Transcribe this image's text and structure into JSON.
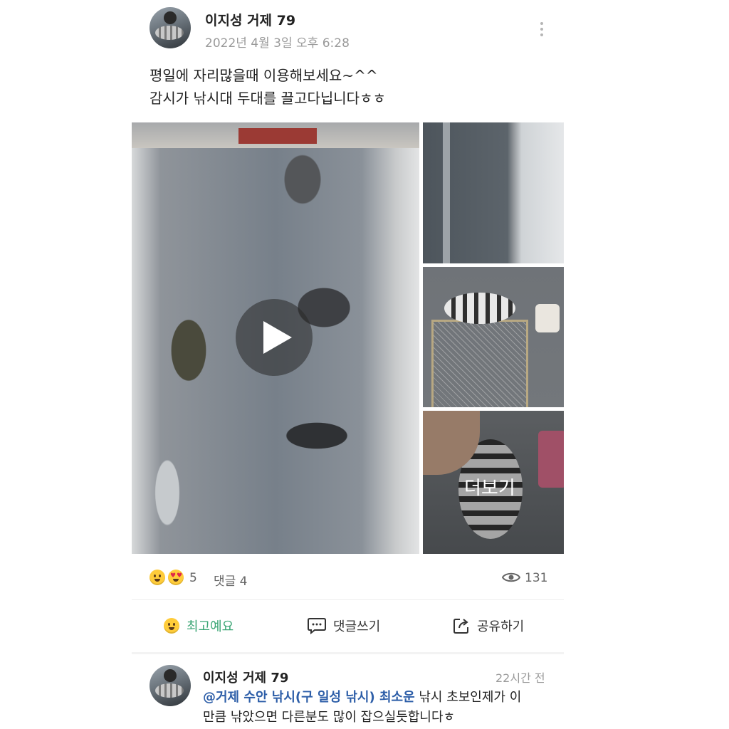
{
  "post": {
    "author": "이지성 거제 79",
    "timestamp": "2022년 4월 3일 오후 6:28",
    "text_line1": "평일에 자리많을때 이용해보세요~^^",
    "text_line2": "감시가 낚시대 두대를 끌고다닙니다ㅎㅎ",
    "media": {
      "more_label": "더보기"
    },
    "stats": {
      "reaction_count": "5",
      "comment_count_label": "댓글 4",
      "view_count": "131"
    },
    "actions": {
      "like_label": "최고예요",
      "comment_label": "댓글쓰기",
      "share_label": "공유하기"
    }
  },
  "comment": {
    "author": "이지성 거제 79",
    "time": "22시간 전",
    "mention": "@거제 수안 낚시(구 일성 낚시) 최소운",
    "text_part1": " 낚시 초보인제가 이",
    "text_part2": "만큼 낚았으면 다른분도 많이 잡으실듯합니다ㅎ"
  },
  "colors": {
    "like_green": "#3aa574",
    "mention_blue": "#2d5ea8",
    "emoji_yellow": "#ffcc3a"
  }
}
